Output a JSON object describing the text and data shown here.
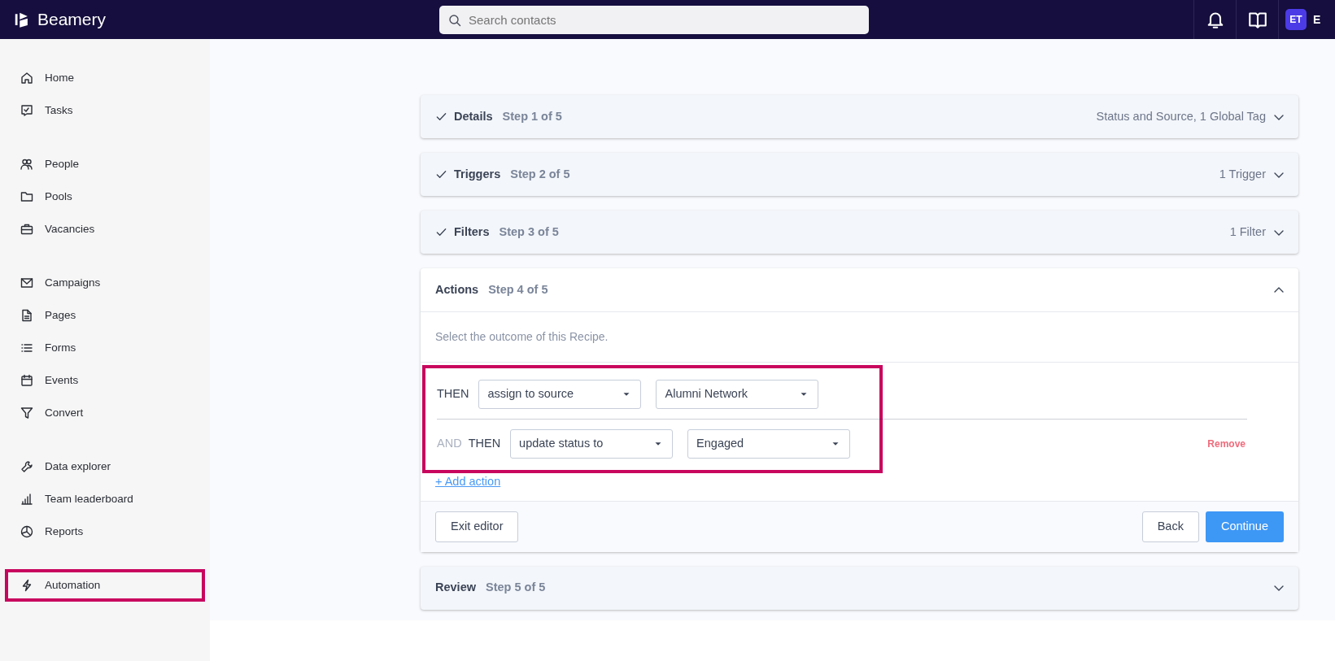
{
  "topbar": {
    "logo": "Beamery",
    "search": {
      "placeholder": "Search contacts"
    },
    "avatar": "ET",
    "user_name_partial": "E"
  },
  "sidebar": {
    "groups": [
      {
        "items": [
          {
            "label": "Home",
            "highlighted": false
          },
          {
            "label": "Tasks",
            "highlighted": false
          }
        ]
      },
      {
        "items": [
          {
            "label": "People",
            "highlighted": false
          },
          {
            "label": "Pools",
            "highlighted": false
          },
          {
            "label": "Vacancies",
            "highlighted": false
          }
        ]
      },
      {
        "items": [
          {
            "label": "Campaigns",
            "highlighted": false
          },
          {
            "label": "Pages",
            "highlighted": false
          },
          {
            "label": "Forms",
            "highlighted": false
          },
          {
            "label": "Events",
            "highlighted": false
          },
          {
            "label": "Convert",
            "highlighted": false
          }
        ]
      },
      {
        "items": [
          {
            "label": "Data explorer",
            "highlighted": false
          },
          {
            "label": "Team leaderboard",
            "highlighted": false
          },
          {
            "label": "Reports",
            "highlighted": false
          }
        ]
      },
      {
        "items": [
          {
            "label": "Automation",
            "highlighted": true
          }
        ]
      }
    ]
  },
  "steps": [
    {
      "title": "Details",
      "step": "Step 1 of 5",
      "done": true,
      "expanded": false,
      "summary": "Status and Source, 1 Global Tag"
    },
    {
      "title": "Triggers",
      "step": "Step 2 of 5",
      "done": true,
      "expanded": false,
      "summary": "1 Trigger"
    },
    {
      "title": "Filters",
      "step": "Step 3 of 5",
      "done": true,
      "expanded": false,
      "summary": "1 Filter"
    },
    {
      "title": "Actions",
      "step": "Step 4 of 5",
      "done": false,
      "expanded": true,
      "description": "Select the outcome of this Recipe.",
      "actions_highlighted": true,
      "actions": [
        {
          "keyword": "THEN",
          "action": "assign to source",
          "value": "Alumni Network"
        },
        {
          "prefix": "AND",
          "keyword": "THEN",
          "action": "update status to",
          "value": "Engaged",
          "remove": "Remove"
        }
      ],
      "add_action": "+ Add action",
      "exit": "Exit editor",
      "back": "Back",
      "continue": "Continue"
    },
    {
      "title": "Review",
      "step": "Step 5 of 5",
      "done": false,
      "expanded": false
    }
  ]
}
